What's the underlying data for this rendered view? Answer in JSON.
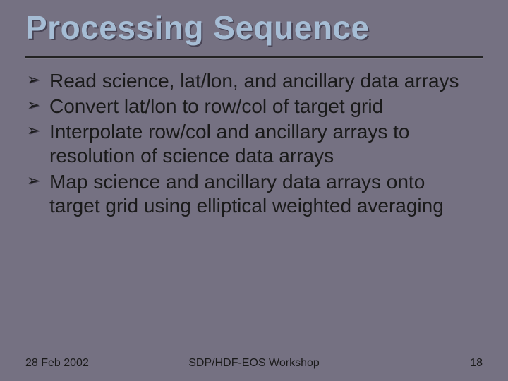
{
  "title": "Processing Sequence",
  "bullets": [
    "Read science, lat/lon, and ancillary data arrays",
    "Convert lat/lon to row/col of target grid",
    "Interpolate row/col and ancillary arrays to resolution of science data arrays",
    "Map science and ancillary data arrays onto target grid using elliptical weighted averaging"
  ],
  "footer": {
    "date": "28 Feb 2002",
    "center": "SDP/HDF-EOS Workshop",
    "page": "18"
  }
}
